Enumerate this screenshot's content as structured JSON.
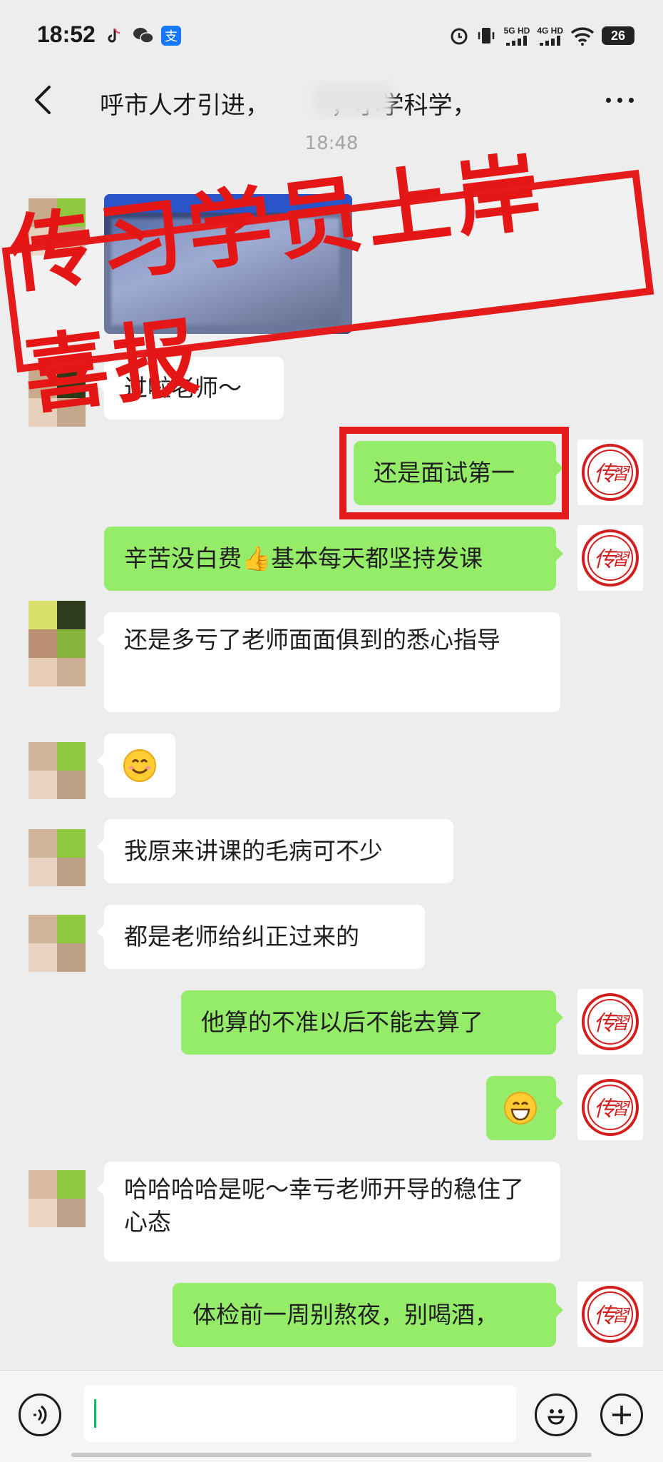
{
  "status_bar": {
    "time": "18:52",
    "network1": "5G HD",
    "network2": "4G HD",
    "battery": "26",
    "icons": [
      "tiktok-icon",
      "wechat-icon",
      "alipay-icon",
      "alarm-icon",
      "vibrate-icon",
      "signal-icon",
      "wifi-icon",
      "battery-icon"
    ]
  },
  "header": {
    "title": "呼市人才引进，        ，小学科学，",
    "back_icon": "back-chevron-icon",
    "more_icon": "more-dots-icon"
  },
  "chat": {
    "timestamp": "18:48",
    "stamp_text": "传习学员上岸喜报",
    "messages": [
      {
        "side": "in",
        "type": "image",
        "alt": "网上报名系统截图"
      },
      {
        "side": "in",
        "text": "过啦老师～"
      },
      {
        "side": "out",
        "text": "还是面试第一",
        "highlighted": true
      },
      {
        "side": "out",
        "text": "辛苦没白费👍基本每天都坚持发课"
      },
      {
        "side": "in",
        "text": "还是多亏了老师面面俱到的悉心指导"
      },
      {
        "side": "in",
        "type": "emoji",
        "emoji": "smile"
      },
      {
        "side": "in",
        "text": "我原来讲课的毛病可不少"
      },
      {
        "side": "in",
        "text": "都是老师给纠正过来的"
      },
      {
        "side": "out",
        "text": "他算的不准以后不能去算了"
      },
      {
        "side": "out",
        "type": "emoji",
        "emoji": "grin"
      },
      {
        "side": "in",
        "text": "哈哈哈哈是呢～幸亏老师开导的稳住了心态"
      },
      {
        "side": "out",
        "text": "体检前一周别熬夜，别喝酒，"
      }
    ]
  },
  "input_bar": {
    "voice_icon": "voice-icon",
    "emoji_icon": "emoji-icon",
    "add_icon": "add-icon",
    "value": ""
  },
  "colors": {
    "background": "#ededed",
    "bubble_out": "#95ec69",
    "bubble_in": "#ffffff",
    "stamp_red": "#e51a1a"
  }
}
